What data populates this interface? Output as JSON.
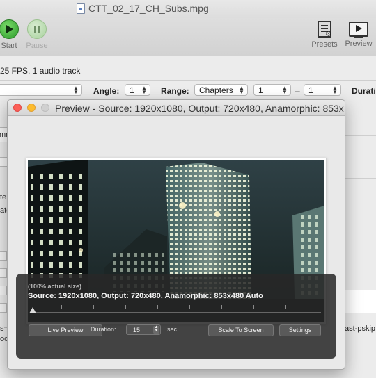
{
  "main_window": {
    "file_title": "CTT_02_17_CH_Subs.mpg",
    "toolbar": {
      "start_label": "Start",
      "pause_label": "Pause",
      "presets_label": "Presets",
      "preview_label": "Preview"
    },
    "source_info": "25 FPS, 1 audio track",
    "range_row": {
      "angle_label": "Angle:",
      "angle_value": "1",
      "range_label": "Range:",
      "range_type": "Chapters",
      "range_start": "1",
      "range_sep": "–",
      "range_end": "1",
      "duration_label": "Duratio"
    },
    "side_fragments": {
      "frag_mn": "mn",
      "frag_te": "te",
      "frag_ate": "ate",
      "frag_s": "s=",
      "frag_oo": "oo",
      "frag_ast": "ast-pskip"
    }
  },
  "preview_window": {
    "title": "Preview - Source: 1920x1080, Output: 720x480, Anamorphic: 853x...",
    "hud": {
      "size_note": "(100% actual size)",
      "source_line": "Source: 1920x1080, Output: 720x480, Anamorphic: 853x480 Auto",
      "live_preview_label": "Live Preview",
      "duration_label": "Duration:",
      "duration_value": "15",
      "sec_label": "sec",
      "scale_to_screen_label": "Scale To Screen",
      "settings_label": "Settings",
      "slider_position": 0.0
    }
  },
  "colors": {
    "close": "#fc5f57",
    "minimize": "#fdbc2e",
    "hud_bg": "#282828",
    "start_green": "#2b9a2a"
  }
}
